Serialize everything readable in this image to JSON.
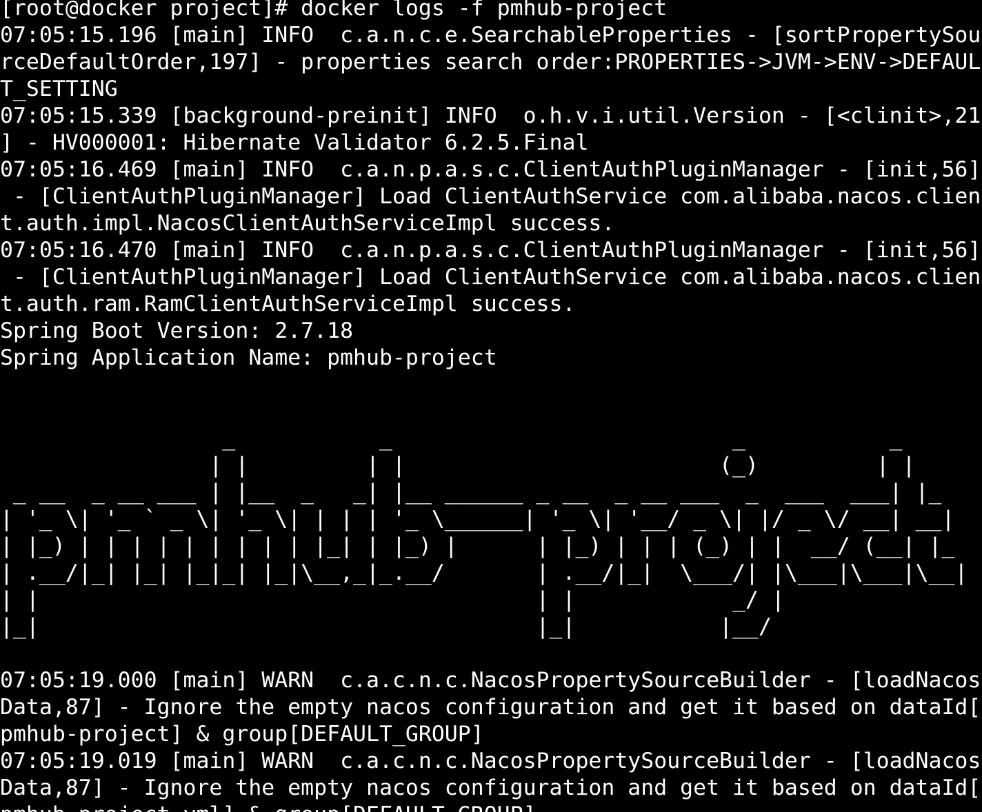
{
  "terminal": {
    "colors": {
      "background": "#000000",
      "foreground": "#ffffff"
    },
    "lines": [
      "[root@docker project]# docker logs -f pmhub-project",
      "07:05:15.196 [main] INFO  c.a.n.c.e.SearchableProperties - [sortPropertySou",
      "rceDefaultOrder,197] - properties search order:PROPERTIES->JVM->ENV->DEFAUL",
      "T_SETTING",
      "07:05:15.339 [background-preinit] INFO  o.h.v.i.util.Version - [<clinit>,21",
      "] - HV000001: Hibernate Validator 6.2.5.Final",
      "07:05:16.469 [main] INFO  c.a.n.p.a.s.c.ClientAuthPluginManager - [init,56]",
      " - [ClientAuthPluginManager] Load ClientAuthService com.alibaba.nacos.clien",
      "t.auth.impl.NacosClientAuthServiceImpl success.",
      "07:05:16.470 [main] INFO  c.a.n.p.a.s.c.ClientAuthPluginManager - [init,56]",
      " - [ClientAuthPluginManager] Load ClientAuthService com.alibaba.nacos.clien",
      "t.auth.ram.RamClientAuthServiceImpl success.",
      "Spring Boot Version: 2.7.18",
      "Spring Application Name: pmhub-project",
      "",
      "",
      "                 _           _                          _           _   ",
      "                | |         | |                        (_)         | |  ",
      " _ __  _ __ ___ | |__  _   _| |__ ______ _ __  _ __ ___  _  ___  ___| |_ ",
      "| '_ \\| '_ ` _ \\| '_ \\| | | | '_ \\______| '_ \\| '__/ _ \\| |/ _ \\/ __| __|",
      "| |_) | | | | | | | | | |_| | |_) |      | |_) | | | (_) | |  __/ (__| |_ ",
      "| .__/|_| |_| |_|_| |_|\\__,_|_.__/       | .__/|_|  \\___/| |\\___|\\___|\\__|",
      "| |                                      | |            _/ |              ",
      "|_|                                      |_|           |__/               ",
      "",
      "07:05:19.000 [main] WARN  c.a.c.n.c.NacosPropertySourceBuilder - [loadNacos",
      "Data,87] - Ignore the empty nacos configuration and get it based on dataId[",
      "pmhub-project] & group[DEFAULT_GROUP]",
      "07:05:19.019 [main] WARN  c.a.c.n.c.NacosPropertySourceBuilder - [loadNacos",
      "Data,87] - Ignore the empty nacos configuration and get it based on dataId[",
      "pmhub-project.yml] & group[DEFAULT_GROUP]"
    ]
  }
}
